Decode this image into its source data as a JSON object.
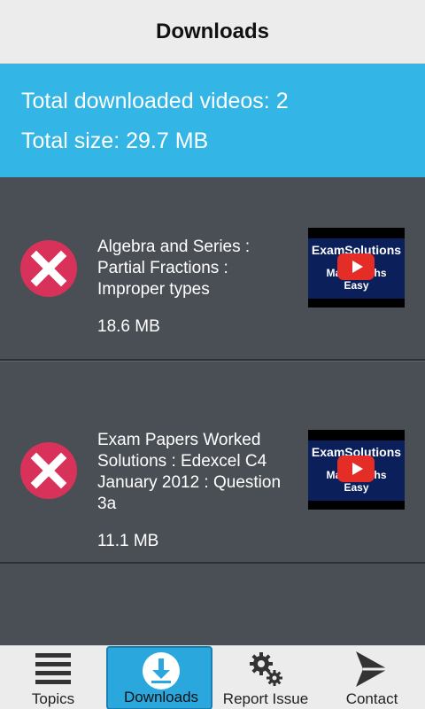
{
  "header": {
    "title": "Downloads"
  },
  "summary": {
    "total_videos": "Total downloaded videos: 2",
    "total_size": "Total size: 29.7 MB"
  },
  "downloads": [
    {
      "title": "Algebra and Series : Partial Fractions : Improper types",
      "size": "18.6 MB",
      "thumb_top": "ExamSolutions",
      "thumb_bottom_1": "Make Maths",
      "thumb_bottom_2": "Easy"
    },
    {
      "title": "Exam Papers Worked Solutions : Edexcel C4 January 2012 : Question 3a",
      "size": "11.1 MB",
      "thumb_top": "ExamSolutions",
      "thumb_bottom_1": "Make Maths",
      "thumb_bottom_2": "Easy"
    }
  ],
  "nav": {
    "items": [
      {
        "label": "Topics",
        "icon": "list-icon"
      },
      {
        "label": "Downloads",
        "icon": "download-icon"
      },
      {
        "label": "Report Issue",
        "icon": "gear-icon"
      },
      {
        "label": "Contact",
        "icon": "send-icon"
      }
    ],
    "active": "Downloads"
  },
  "colors": {
    "accent": "#33b5e5",
    "delete": "#d9325a",
    "list_bg": "#4a4f55"
  }
}
